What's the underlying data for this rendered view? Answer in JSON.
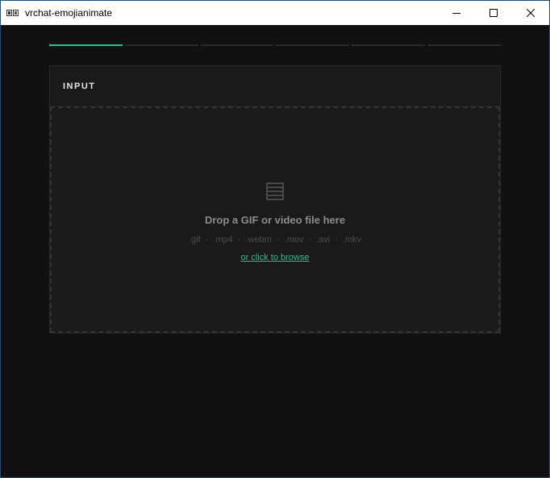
{
  "window": {
    "title": "vrchat-emojianimate",
    "controls": {
      "minimize": "minimize-icon",
      "maximize": "maximize-icon",
      "close": "close-icon"
    }
  },
  "steps": {
    "total": 6,
    "active_index": 0,
    "accent_color": "#2fbf8a"
  },
  "input_panel": {
    "title": "INPUT",
    "dropzone": {
      "icon": "file-list-icon",
      "prompt": "Drop a GIF or video file here",
      "formats": [
        ".gif",
        ".mp4",
        ".webm",
        ".mov",
        ".avi",
        ".mkv"
      ],
      "separator": "·",
      "browse_label": "or click to browse"
    }
  }
}
